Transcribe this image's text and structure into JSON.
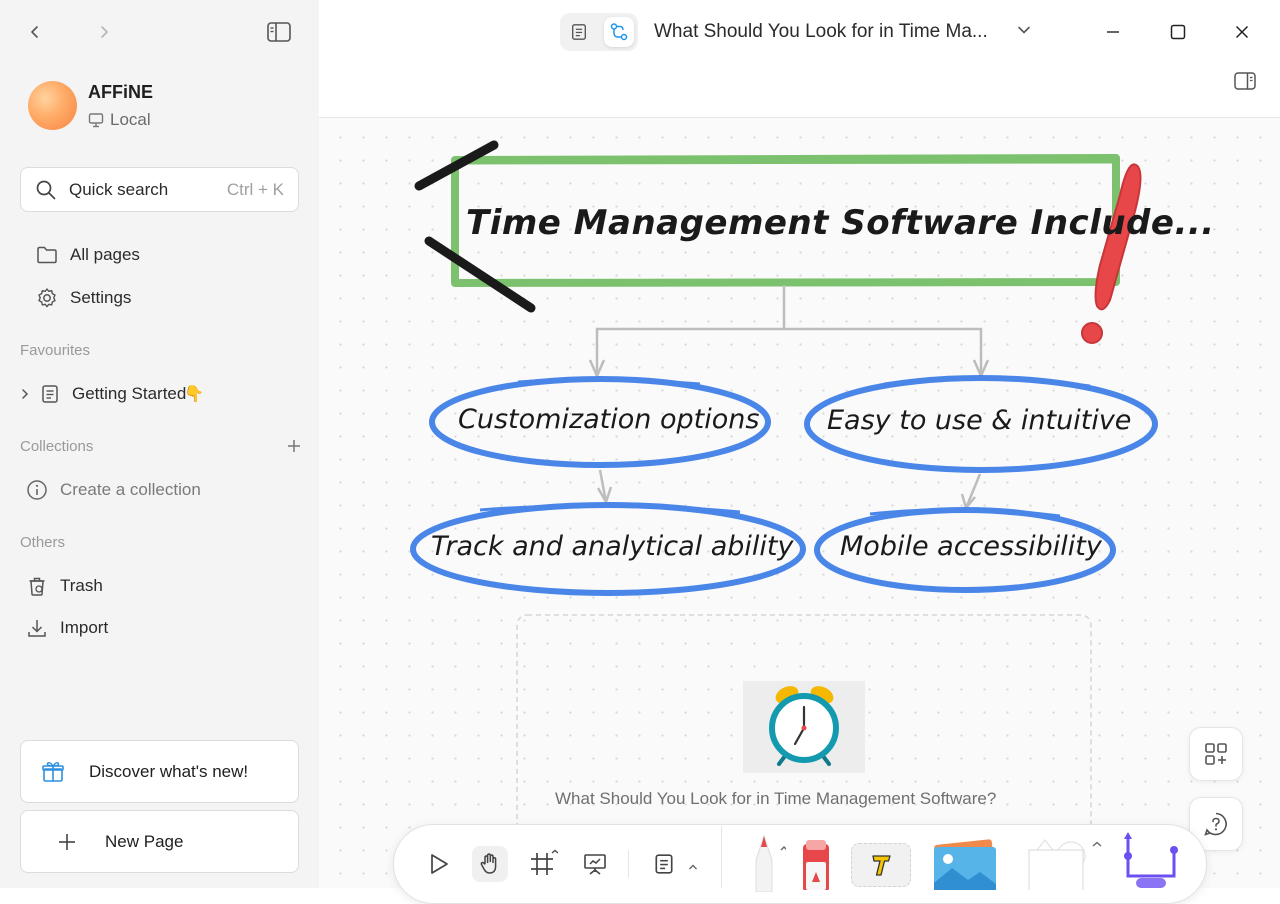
{
  "sidebar": {
    "workspace": {
      "name": "AFFiNE",
      "location": "Local"
    },
    "search": {
      "label": "Quick search",
      "shortcut": "Ctrl + K"
    },
    "nav": [
      {
        "label": "All pages",
        "icon": "folder-icon"
      },
      {
        "label": "Settings",
        "icon": "gear-icon"
      }
    ],
    "favourites": {
      "title": "Favourites",
      "items": [
        {
          "label": "Getting Started",
          "emoji": "👇"
        }
      ]
    },
    "collections": {
      "title": "Collections",
      "create_label": "Create a collection"
    },
    "others": {
      "title": "Others",
      "items": [
        {
          "label": "Trash"
        },
        {
          "label": "Import"
        }
      ]
    },
    "discover_label": "Discover what's new!",
    "new_page_label": "New Page"
  },
  "header": {
    "doc_title": "What Should You Look for in Time Ma...",
    "active_mode": "edgeless"
  },
  "canvas": {
    "main_title": "Time Management Software Include...",
    "nodes": {
      "top_left": "Customization options",
      "top_right": "Easy to use & intuitive",
      "bottom_left": "Track and analytical ability",
      "bottom_right": "Mobile accessibility"
    },
    "note_caption": "What Should You Look for in Time Management Software?",
    "colors": {
      "frame": "#7cc26e",
      "ellipse": "#4a86e8",
      "exclamation": "#e8474a",
      "arrows": "#bdbdbd"
    }
  },
  "toolbar": {
    "tools": [
      "select-tool",
      "hand-tool",
      "frame-tool",
      "presentation-tool",
      "note-tool",
      "pen-tool",
      "eraser-tool",
      "text-tool",
      "image-tool",
      "shape-tool",
      "connector-tool"
    ]
  }
}
